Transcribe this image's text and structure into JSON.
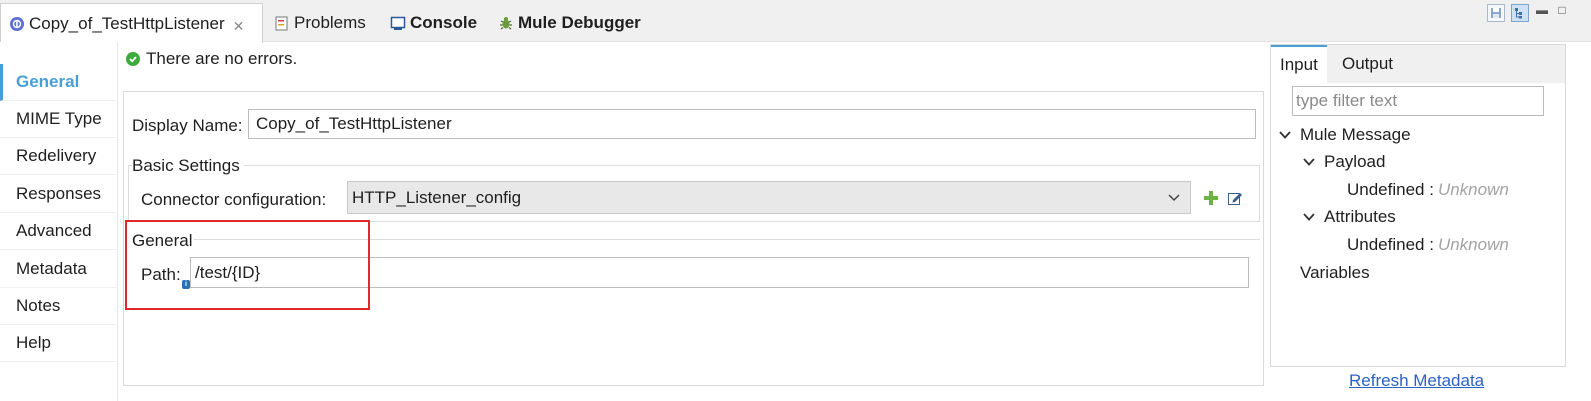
{
  "tabs": [
    {
      "label": "Copy_of_TestHttpListener",
      "icon": "mule-flow-icon",
      "active": true,
      "closable": true
    },
    {
      "label": "Problems",
      "icon": "problems-icon"
    },
    {
      "label": "Console",
      "icon": "console-icon"
    },
    {
      "label": "Mule Debugger",
      "icon": "debugger-icon"
    }
  ],
  "left_nav": {
    "items": [
      "General",
      "MIME Type",
      "Redelivery",
      "Responses",
      "Advanced",
      "Metadata",
      "Notes",
      "Help"
    ],
    "active": "General"
  },
  "status": {
    "text": "There are no errors.",
    "icon": "ok-icon"
  },
  "form": {
    "display_name_label": "Display Name:",
    "display_name_value": "Copy_of_TestHttpListener",
    "basic_settings_title": "Basic Settings",
    "connector_config_label": "Connector configuration:",
    "connector_config_value": "HTTP_Listener_config",
    "general_group_title": "General",
    "path_label": "Path:",
    "path_value": "/test/{ID}"
  },
  "metadata_panel": {
    "tabs": [
      "Input",
      "Output"
    ],
    "active_tab": "Input",
    "filter_placeholder": "type filter text",
    "tree": {
      "root": "Mule Message",
      "payload": "Payload",
      "payload_undefined": "Undefined :",
      "payload_type": "Unknown",
      "attributes": "Attributes",
      "attributes_undefined": "Undefined :",
      "attributes_type": "Unknown",
      "variables": "Variables"
    },
    "refresh_link": "Refresh Metadata"
  },
  "colors": {
    "accent": "#4a9ed6",
    "highlight_border": "#e0282e",
    "link": "#2a63c4",
    "ok_green": "#3daa3d"
  }
}
